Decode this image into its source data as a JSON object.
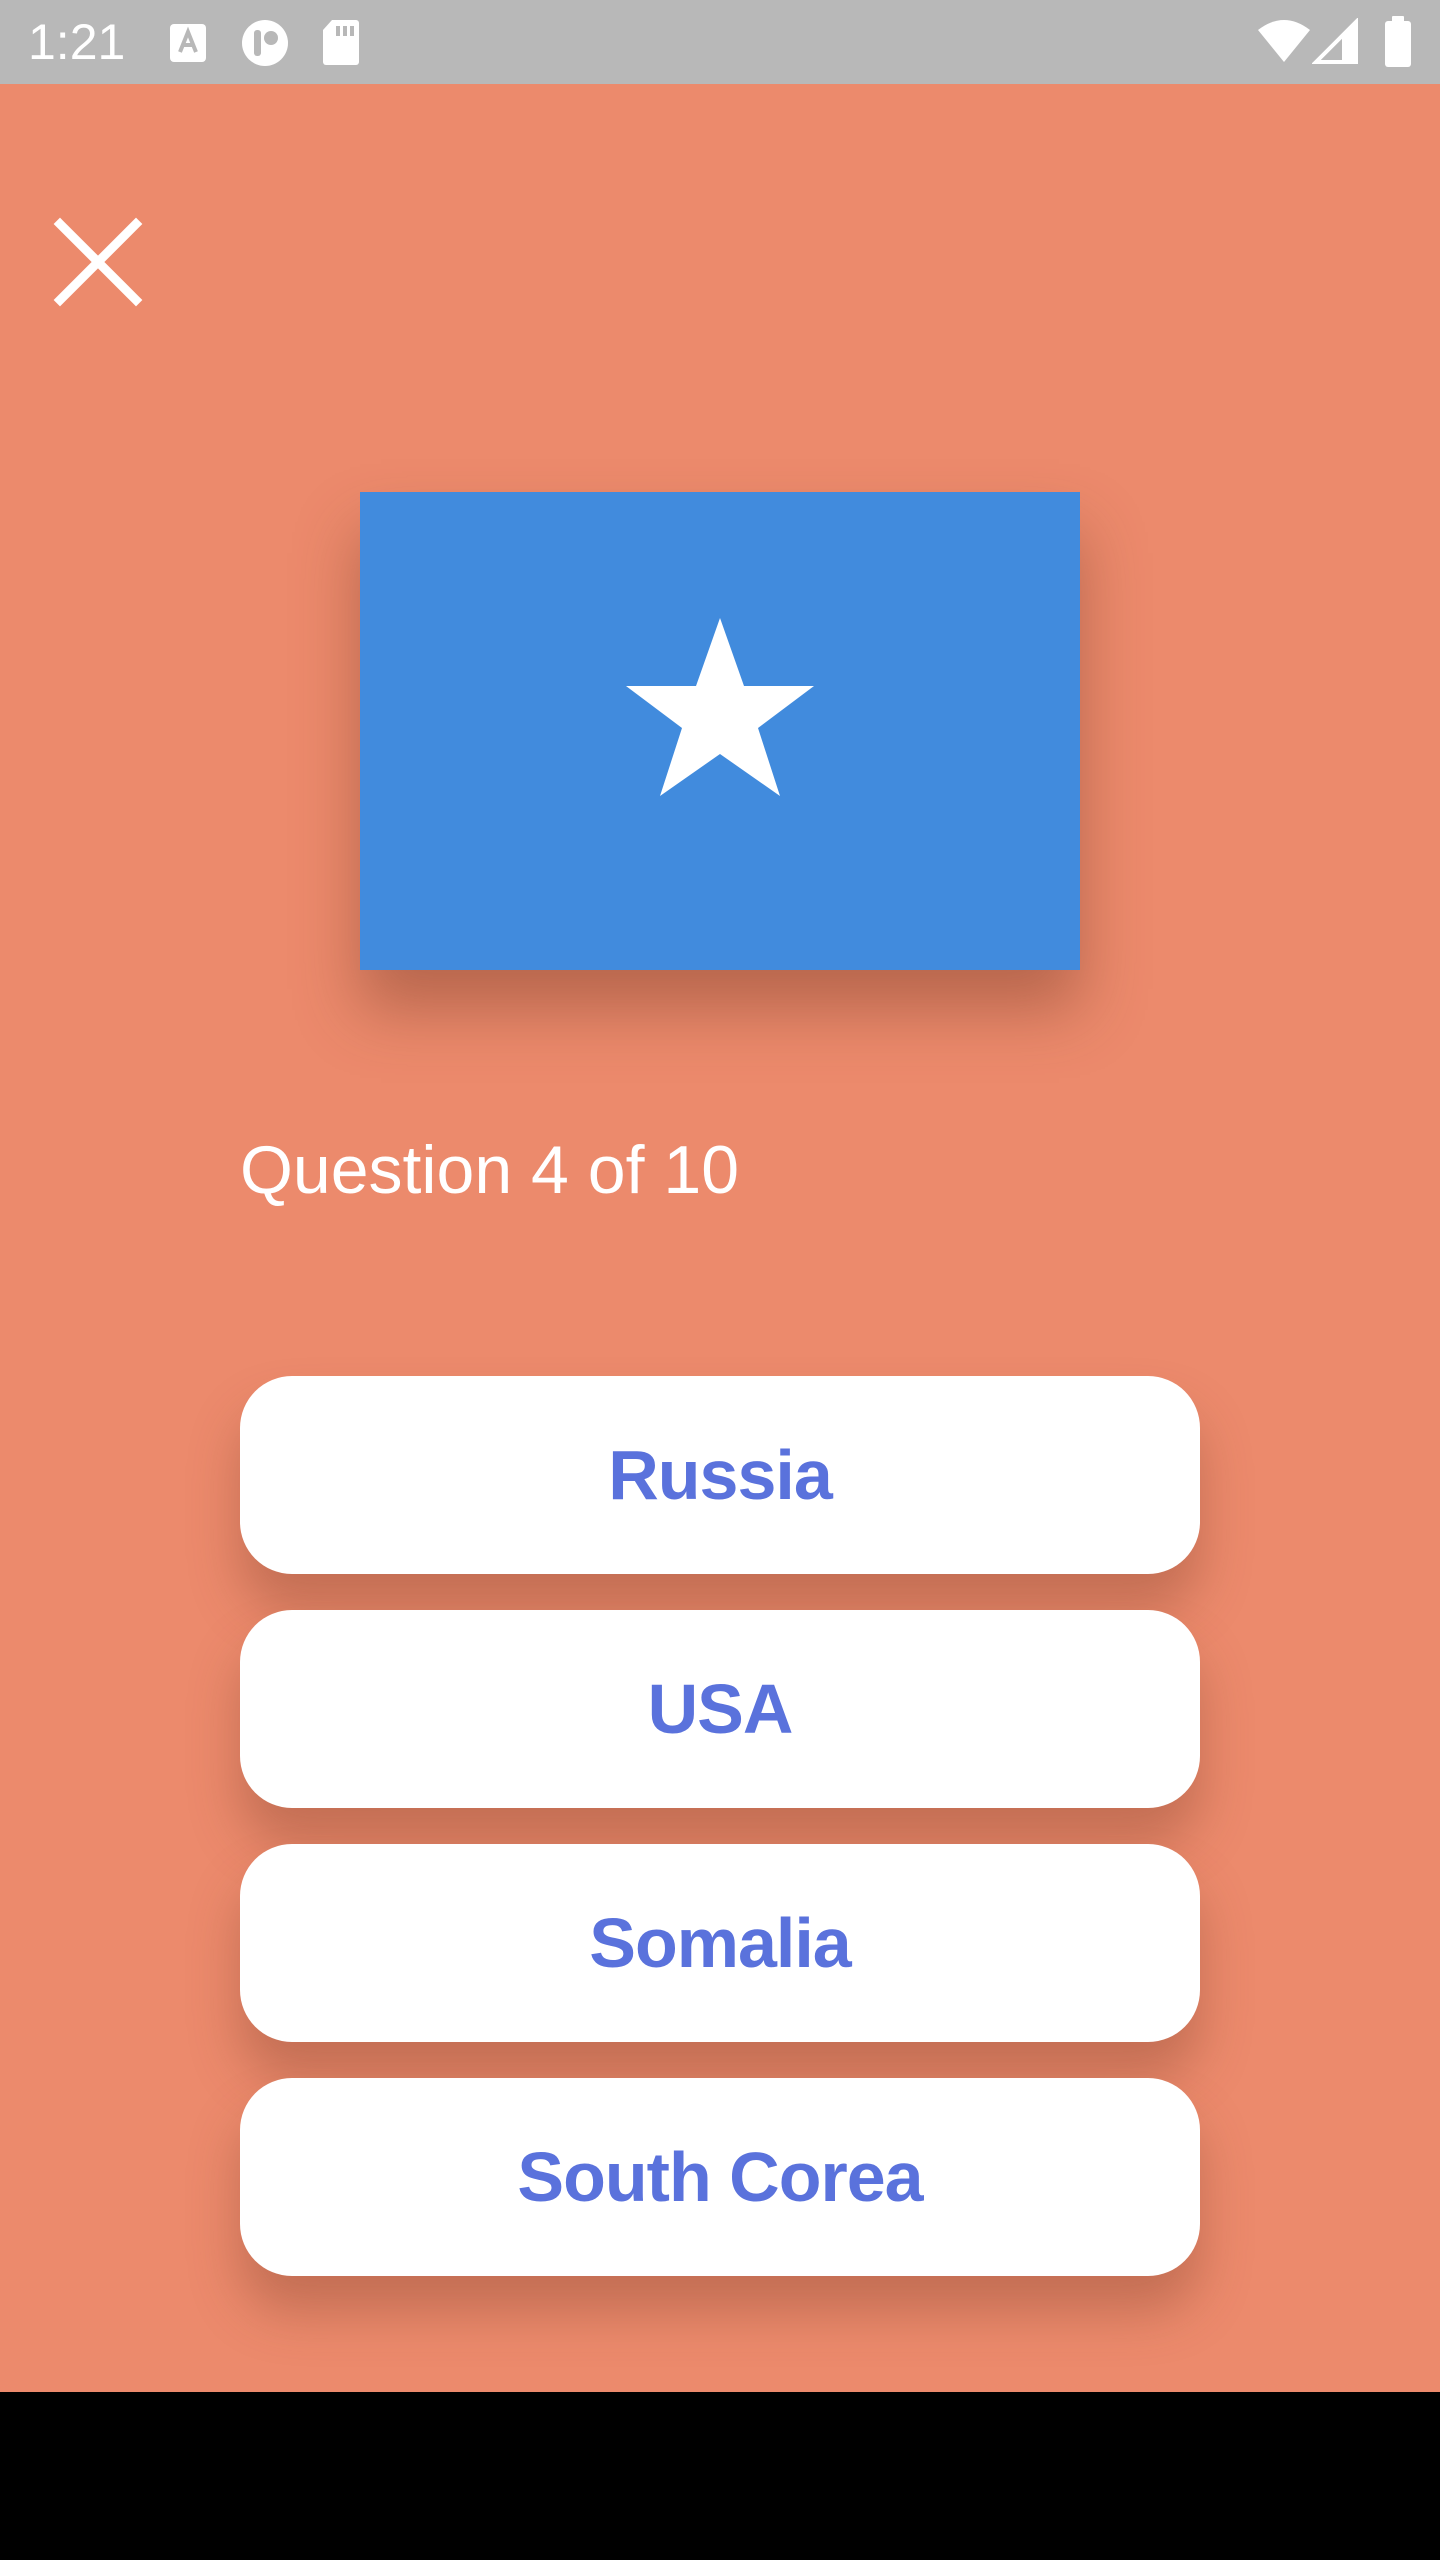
{
  "status_bar": {
    "time": "1:21",
    "icons": [
      "keyboard-a-icon",
      "app-notification-icon",
      "sd-card-icon",
      "wifi-icon",
      "cellular-signal-icon",
      "battery-icon"
    ]
  },
  "quiz": {
    "close_icon": "close-icon",
    "flag_icon": "somalia-flag-star-icon",
    "question_label": "Question 4 of 10",
    "answers": [
      {
        "label": "Russia"
      },
      {
        "label": "USA"
      },
      {
        "label": "Somalia"
      },
      {
        "label": "South Corea"
      }
    ]
  },
  "colors": {
    "background": "#ec8a6c",
    "flag_blue": "#418bdd",
    "answer_text": "#5a72dc",
    "status_bar": "#b8b8b8"
  }
}
